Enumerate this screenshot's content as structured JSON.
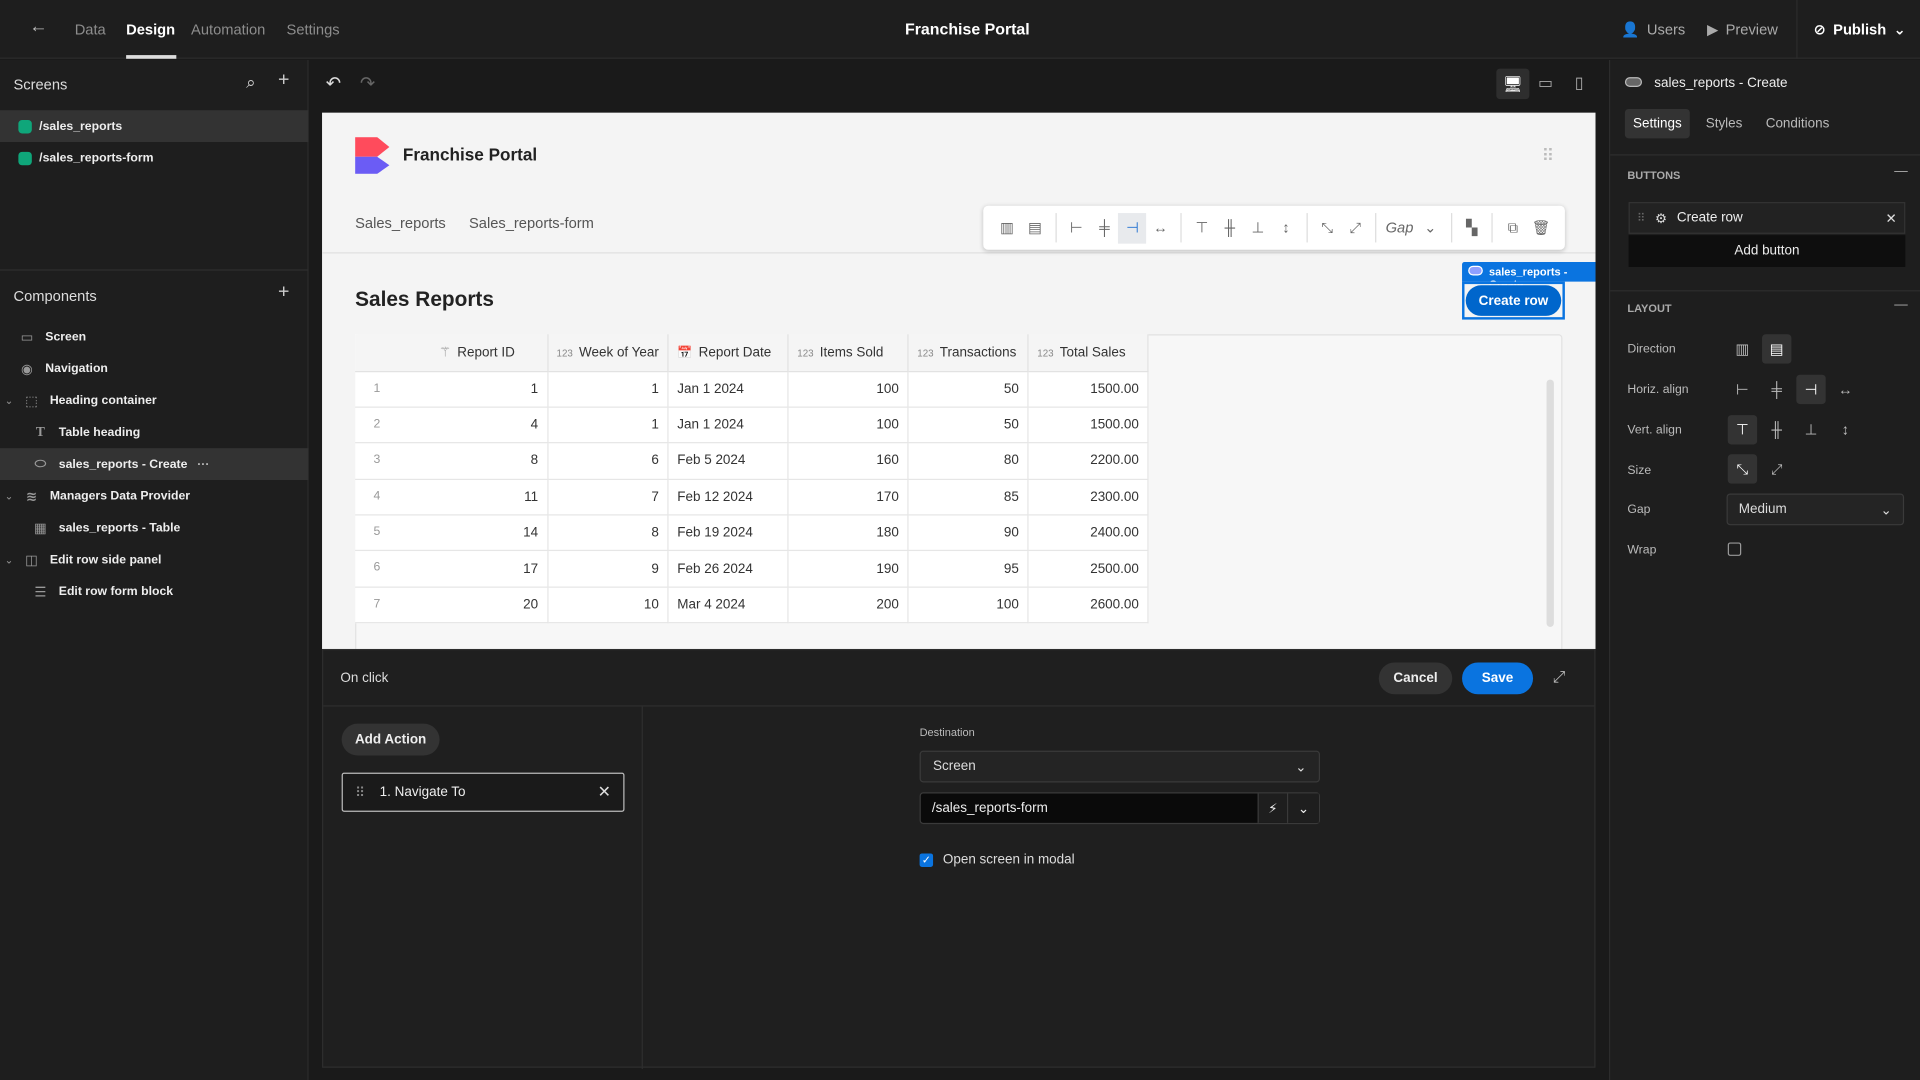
{
  "topbar": {
    "tabs": [
      "Data",
      "Design",
      "Automation",
      "Settings"
    ],
    "active_tab": "Design",
    "title": "Franchise Portal",
    "users": "Users",
    "preview": "Preview",
    "publish": "Publish"
  },
  "screens": {
    "title": "Screens",
    "items": [
      "/sales_reports",
      "/sales_reports-form"
    ],
    "selected": "/sales_reports",
    "color": "#0fa67a"
  },
  "components": {
    "title": "Components",
    "items": [
      {
        "label": "Screen",
        "icon": "screen-icon"
      },
      {
        "label": "Navigation",
        "icon": "eye-icon"
      },
      {
        "label": "Heading container",
        "icon": "container-icon"
      },
      {
        "label": "Table heading",
        "icon": "text-icon"
      },
      {
        "label": "sales_reports - Create",
        "icon": "button-icon"
      },
      {
        "label": "Managers Data Provider",
        "icon": "database-icon"
      },
      {
        "label": "sales_reports - Table",
        "icon": "table-icon"
      },
      {
        "label": "Edit row side panel",
        "icon": "side-panel-icon"
      },
      {
        "label": "Edit row form block",
        "icon": "form-icon"
      }
    ]
  },
  "canvas": {
    "app_title": "Franchise Portal",
    "nav_links": [
      "Sales_reports",
      "Sales_reports-form"
    ],
    "heading": "Sales Reports",
    "toolbar_gap": "Gap",
    "selection_label": "sales_reports - Create",
    "create_button": "Create row",
    "accent": "#0066cc"
  },
  "table": {
    "columns": [
      "Report ID",
      "Week of Year",
      "Report Date",
      "Items Sold",
      "Transactions",
      "Total Sales"
    ],
    "rows": [
      [
        "1",
        "1",
        "1",
        "Jan 1 2024",
        "100",
        "50",
        "1500.00"
      ],
      [
        "2",
        "4",
        "1",
        "Jan 1 2024",
        "100",
        "50",
        "1500.00"
      ],
      [
        "3",
        "8",
        "6",
        "Feb 5 2024",
        "160",
        "80",
        "2200.00"
      ],
      [
        "4",
        "11",
        "7",
        "Feb 12 2024",
        "170",
        "85",
        "2300.00"
      ],
      [
        "5",
        "14",
        "8",
        "Feb 19 2024",
        "180",
        "90",
        "2400.00"
      ],
      [
        "6",
        "17",
        "9",
        "Feb 26 2024",
        "190",
        "95",
        "2500.00"
      ],
      [
        "7",
        "20",
        "10",
        "Mar 4 2024",
        "200",
        "100",
        "2600.00"
      ]
    ]
  },
  "onclick": {
    "title": "On click",
    "cancel": "Cancel",
    "save": "Save",
    "add_action": "Add Action",
    "action": "1. Navigate To",
    "destination_label": "Destination",
    "destination_type": "Screen",
    "destination_value": "/sales_reports-form",
    "modal_label": "Open screen in modal",
    "modal_checked": true
  },
  "right": {
    "title": "sales_reports - Create",
    "tabs": [
      "Settings",
      "Styles",
      "Conditions"
    ],
    "active_tab": "Settings",
    "buttons_section": "BUTTONS",
    "button_item": "Create row",
    "add_button": "Add button",
    "layout_section": "LAYOUT",
    "labels": [
      "Direction",
      "Horiz. align",
      "Vert. align",
      "Size",
      "Gap",
      "Wrap"
    ],
    "gap_value": "Medium",
    "wrap_checked": false
  }
}
